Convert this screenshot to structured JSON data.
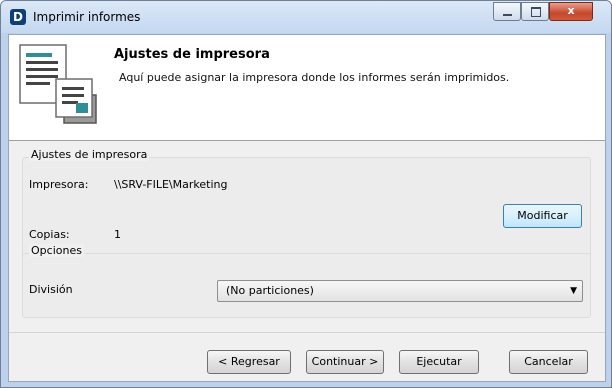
{
  "window": {
    "title": "Imprimir informes",
    "app_icon_letter": "D",
    "controls": {
      "minimize": "minimize-icon",
      "maximize": "maximize-icon",
      "close": "x"
    }
  },
  "header": {
    "title": "Ajustes de impresora",
    "subtitle": "Aquí puede asignar la impresora donde los informes serán imprimidos."
  },
  "printer_settings": {
    "legend": "Ajustes de impresora",
    "printer_label": "Impresora:",
    "printer_value": "\\\\SRV-FILE\\Marketing",
    "copies_label": "Copias:",
    "copies_value": "1",
    "modify_button": "Modificar"
  },
  "options": {
    "legend": "Opciones",
    "division_label": "División",
    "division_value": "(No particiones)"
  },
  "footer": {
    "back_button": "< Regresar",
    "next_button": "Continuar >",
    "execute_button": "Ejecutar",
    "cancel_button": "Cancelar"
  },
  "colors": {
    "title_bar": "#c4d8f0",
    "close_button": "#c7472b",
    "app_icon": "#0e3d7a"
  }
}
